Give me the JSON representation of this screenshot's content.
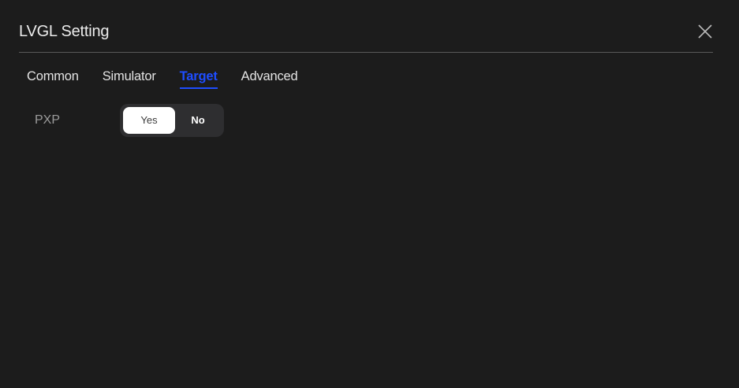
{
  "dialog": {
    "title": "LVGL Setting",
    "close_icon": "close-icon"
  },
  "tabs": [
    {
      "label": "Common",
      "active": false
    },
    {
      "label": "Simulator",
      "active": false
    },
    {
      "label": "Target",
      "active": true
    },
    {
      "label": "Advanced",
      "active": false
    }
  ],
  "settings": {
    "pxp": {
      "label": "PXP",
      "options": [
        "Yes",
        "No"
      ],
      "selected": "Yes"
    }
  },
  "colors": {
    "background": "#1c1c1c",
    "accent": "#1e4dff",
    "toggle_track": "#2e2e30",
    "toggle_selected": "#ffffff"
  }
}
